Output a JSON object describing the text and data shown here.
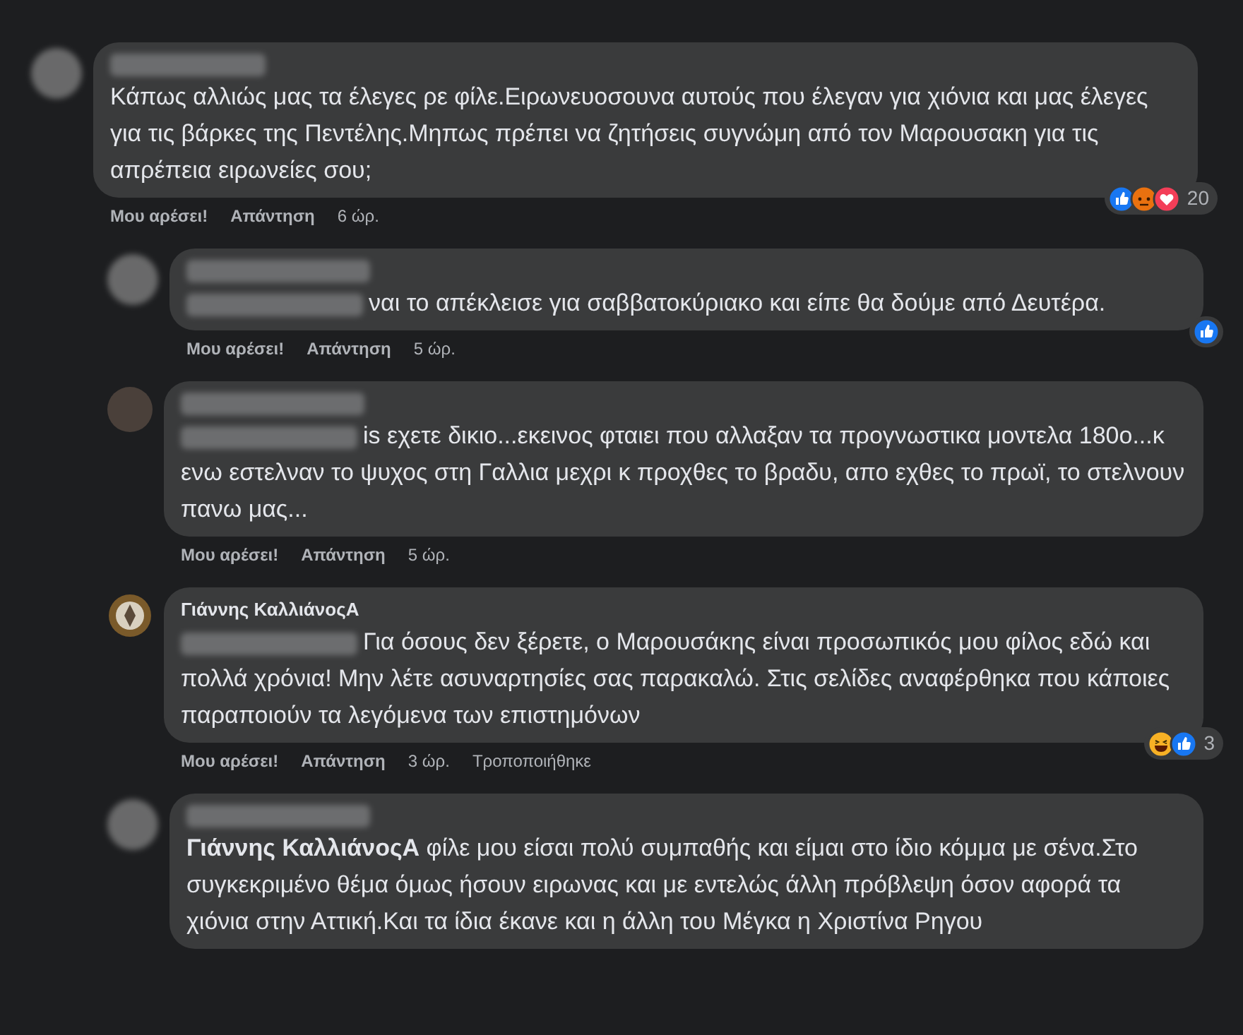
{
  "comments": [
    {
      "reply": false,
      "avatar": {
        "kind": "blurred"
      },
      "mention_blurred": false,
      "text": "Κάπως αλλιώς μας τα έλεγες ρε φίλε.Ειρωνευοσουνα αυτούς που έλεγαν για χιόνια και μας έλεγες για τις βάρκες της Πεντέλης.Μηπως πρέπει να ζητήσεις συγνώμη από τον Μαρουσακη για τις απρέπεια ειρωνείες σου;",
      "actions": {
        "like": "Μου αρέσει!",
        "reply": "Απάντηση",
        "time": "6 ώρ."
      },
      "reactions": [
        {
          "kind": "like"
        },
        {
          "kind": "angry"
        },
        {
          "kind": "love"
        }
      ],
      "reaction_count": "20"
    },
    {
      "reply": true,
      "avatar": {
        "kind": "blurred"
      },
      "mention_blurred": true,
      "text": "ναι το απέκλεισε για σαββατοκύριακο και είπε θα δούμε από Δευτέρα.",
      "actions": {
        "like": "Μου αρέσει!",
        "reply": "Απάντηση",
        "time": "5 ώρ."
      },
      "reactions": [
        {
          "kind": "like"
        }
      ]
    },
    {
      "reply": true,
      "avatar": {
        "kind": "dark"
      },
      "mention_blurred": true,
      "text": "is εχετε δικιο...εκεινος φταιει που αλλαξαν τα προγνωστικα μοντελα 180ο...κ ενω εστελναν το ψυχος στη Γαλλια μεχρι κ προχθες το βραδυ, απο εχθες το πρωϊ, το στελνουν πανω μας...",
      "actions": {
        "like": "Μου αρέσει!",
        "reply": "Απάντηση",
        "time": "5 ώρ."
      }
    },
    {
      "reply": true,
      "avatar": {
        "kind": "emblem"
      },
      "name": "Γιάννης ΚαλλιάνοςΑ",
      "mention_blurred": true,
      "text": "Για όσους δεν ξέρετε, ο Μαρουσάκης είναι προσωπικός μου φίλος εδώ και πολλά χρόνια! Μην λέτε ασυναρτησίες σας παρακαλώ. Στις σελίδες αναφέρθηκα που κάποιες παραποιούν τα λεγόμενα των επιστημόνων",
      "actions": {
        "like": "Μου αρέσει!",
        "reply": "Απάντηση",
        "time": "3 ώρ.",
        "edited": "Τροποποιήθηκε"
      },
      "reactions": [
        {
          "kind": "haha"
        },
        {
          "kind": "like"
        }
      ],
      "reaction_count": "3"
    },
    {
      "reply": true,
      "avatar": {
        "kind": "blurred"
      },
      "mention_blurred": false,
      "text": "**Γιάννης ΚαλλιάνοςΑ** φίλε μου είσαι πολύ συμπαθής και είμαι στο ίδιο κόμμα με σένα.Στο συγκεκριμένο θέμα όμως ήσουν ειρωνας και με εντελώς άλλη πρόβλεψη όσον αφορά τα χιόνια στην Αττική.Και τα ίδια έκανε και η άλλη του Μέγκα η Χριστίνα Ρηγου"
    }
  ]
}
